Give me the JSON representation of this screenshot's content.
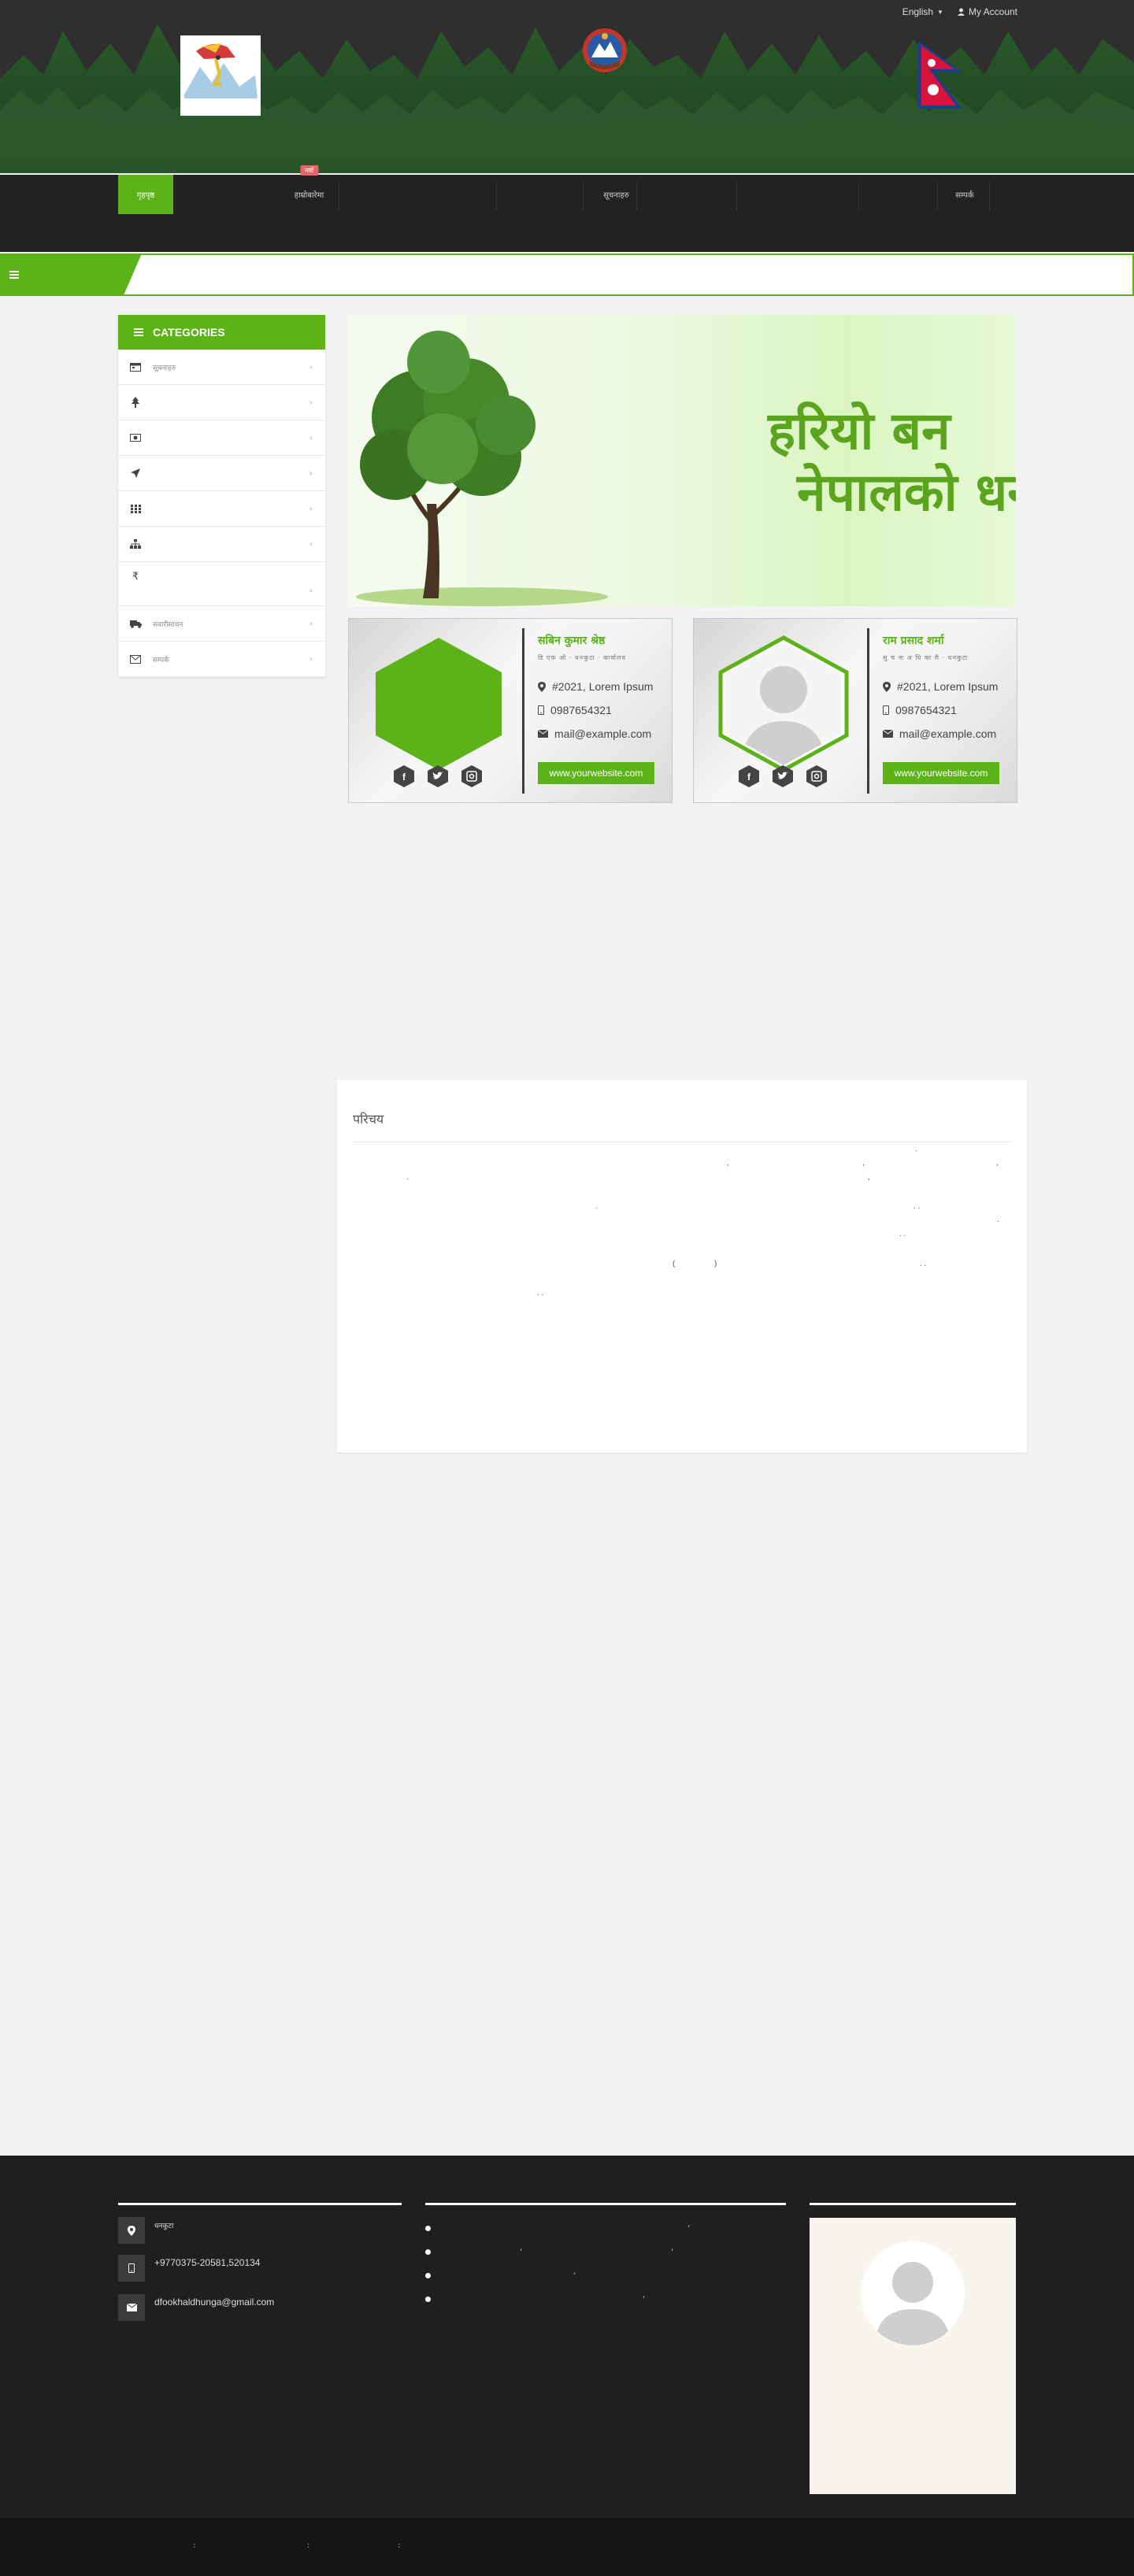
{
  "header": {
    "language": "English",
    "account": "My Account"
  },
  "nav": {
    "items": [
      {
        "label": "गृहपृष्ठ",
        "active": true
      },
      {
        "label": "",
        "active": false
      },
      {
        "label": "हाम्रोबारेमा",
        "active": false,
        "badge": "नयाँ"
      },
      {
        "label": "",
        "active": false
      },
      {
        "label": "",
        "active": false
      },
      {
        "label": "सूचनाहरु",
        "active": false
      },
      {
        "label": "",
        "active": false
      },
      {
        "label": "",
        "active": false
      },
      {
        "label": "सम्पर्क",
        "active": false
      }
    ]
  },
  "sidebar": {
    "title": "CATEGORIES",
    "items": [
      {
        "label": "सूचनाहरु",
        "icon": "calendar-icon"
      },
      {
        "label": "",
        "icon": "tree-icon"
      },
      {
        "label": "",
        "icon": "money-icon"
      },
      {
        "label": "",
        "icon": "location-arrow-icon"
      },
      {
        "label": "",
        "icon": "grid-icon"
      },
      {
        "label": "",
        "icon": "sitemap-icon"
      },
      {
        "label": "",
        "icon": "rupee-icon"
      },
      {
        "label": "सवारीसाधन",
        "icon": "truck-icon"
      },
      {
        "label": "सम्पर्क",
        "icon": "envelope-icon"
      }
    ]
  },
  "banner": {
    "line1": "हरियो बन",
    "line2": "नेपालको धन"
  },
  "cards": [
    {
      "name": "सबिन कुमार श्रेष्ठ",
      "title": "डि एफ ओ · धनकुटा · कार्यालय",
      "address": "#2021, Lorem Ipsum",
      "phone": "0987654321",
      "email": "mail@example.com",
      "website": "www.yourwebsite.com",
      "photo": "green-hexagon"
    },
    {
      "name": "राम प्रसाद शर्मा",
      "title": "सु च ना अ धि का री · धनकुटा",
      "address": "#2021, Lorem Ipsum",
      "phone": "0987654321",
      "email": "mail@example.com",
      "website": "www.yourwebsite.com",
      "photo": "user-placeholder"
    }
  ],
  "article": {
    "title": "परिचय"
  },
  "footer": {
    "address": "धनकुटा",
    "phone": "+9770375-20581,520134",
    "email": "dfookhaldhunga@gmail.com"
  },
  "colors": {
    "accent": "#5bb318",
    "header_bg": "#2f2f2f",
    "footer_bg": "#1f1f1f"
  }
}
